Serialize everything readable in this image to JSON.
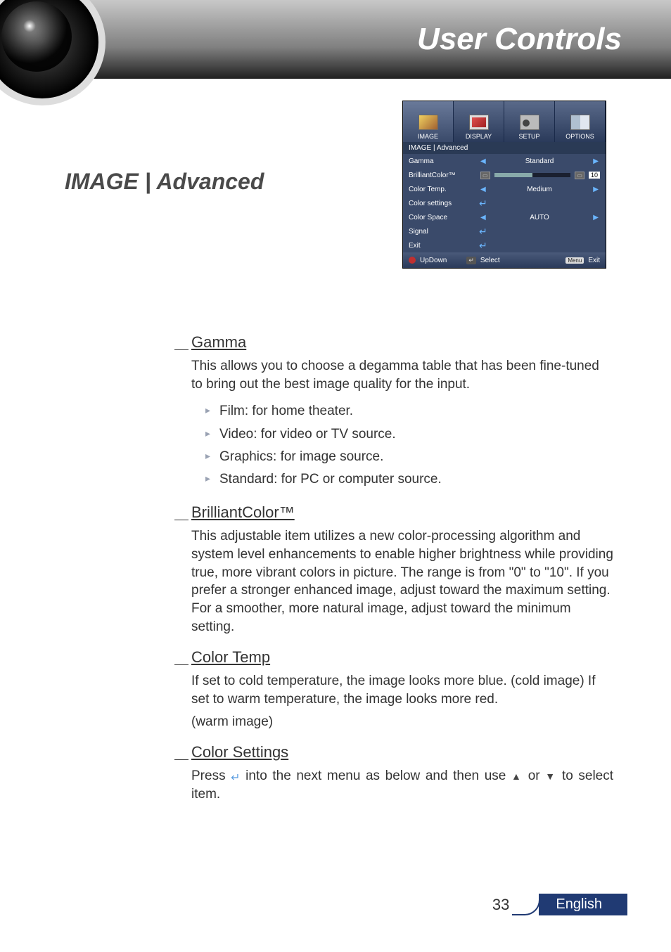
{
  "header": {
    "title": "User Controls"
  },
  "section_title": "IMAGE | Advanced",
  "osd": {
    "tabs": [
      {
        "label": "IMAGE"
      },
      {
        "label": "DISPLAY"
      },
      {
        "label": "SETUP"
      },
      {
        "label": "OPTIONS"
      }
    ],
    "breadcrumb": "IMAGE  |  Advanced",
    "rows": {
      "gamma": {
        "label": "Gamma",
        "value": "Standard"
      },
      "brilliant": {
        "label": "BrilliantColor™",
        "value": "10"
      },
      "colortemp": {
        "label": "Color Temp.",
        "value": "Medium"
      },
      "colorsettings": {
        "label": "Color settings"
      },
      "colorspace": {
        "label": "Color Space",
        "value": "AUTO"
      },
      "signal": {
        "label": "Signal"
      },
      "exit": {
        "label": "Exit"
      }
    },
    "footer": {
      "updown": "UpDown",
      "select": "Select",
      "menu": "Menu",
      "exit": "Exit"
    }
  },
  "sections": {
    "gamma": {
      "heading": "Gamma",
      "intro": "This allows you to choose a degamma table that has been fine-tuned to bring out the best image quality for the input.",
      "items": [
        "Film: for home theater.",
        "Video: for video or TV source.",
        "Graphics: for image source.",
        "Standard: for PC or computer source."
      ]
    },
    "brilliant": {
      "heading": "BrilliantColor™",
      "para": "This adjustable item utilizes a new color-processing algorithm and system level enhancements to enable higher brightness while providing true, more vibrant colors in picture. The range is from \"0\" to \"10\". If you prefer a stronger enhanced image, adjust toward the maximum setting. For a smoother, more natural image, adjust toward the minimum setting."
    },
    "colortemp": {
      "heading": "Color Temp",
      "para1": "If set to cold temperature, the image looks more blue. (cold image) If set to warm temperature, the image looks more red.",
      "para2": "(warm image)"
    },
    "colorsettings": {
      "heading": "Color Settings",
      "press": "Press ",
      "mid": " into the next menu as below and then use ",
      "or": " or ",
      "tail": " to select item."
    }
  },
  "footer": {
    "page": "33",
    "language": "English"
  }
}
